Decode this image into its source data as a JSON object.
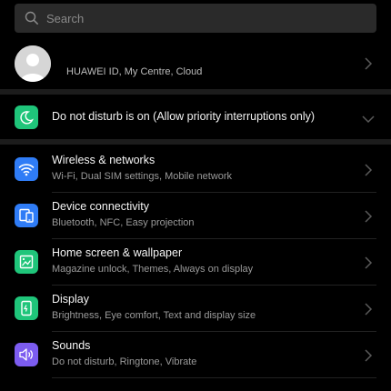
{
  "search": {
    "placeholder": "Search"
  },
  "account": {
    "subtitle": "HUAWEI ID, My Centre, Cloud"
  },
  "do_not_disturb": {
    "label": "Do not disturb is on (Allow priority interruptions only)",
    "icon": "moon-icon",
    "color": "#1fc57a"
  },
  "settings": [
    {
      "title": "Wireless & networks",
      "subtitle": "Wi-Fi, Dual SIM settings, Mobile network",
      "icon": "wifi-icon",
      "color": "#2f7cf6"
    },
    {
      "title": "Device connectivity",
      "subtitle": "Bluetooth, NFC, Easy projection",
      "icon": "device-connectivity-icon",
      "color": "#2f7cf6"
    },
    {
      "title": "Home screen & wallpaper",
      "subtitle": "Magazine unlock, Themes, Always on display",
      "icon": "wallpaper-icon",
      "color": "#1fc57a"
    },
    {
      "title": "Display",
      "subtitle": "Brightness, Eye comfort, Text and display size",
      "icon": "display-icon",
      "color": "#1fc57a"
    },
    {
      "title": "Sounds",
      "subtitle": "Do not disturb, Ringtone, Vibrate",
      "icon": "sound-icon",
      "color": "#7c5cf0"
    }
  ]
}
